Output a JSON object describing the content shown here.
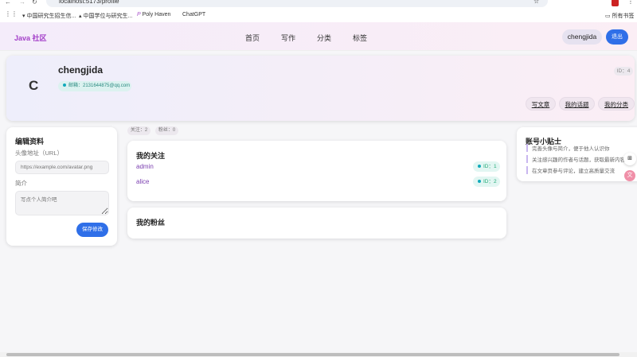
{
  "browser": {
    "url": "localhost:5173/profile",
    "bookmarks": [
      "中国研究生招生信...",
      "中国学位与研究生...",
      "Poly Haven",
      "ChatGPT"
    ],
    "all_bookmarks": "所有书签"
  },
  "nav": {
    "logo": "Java 社区",
    "links": [
      "首页",
      "写作",
      "分类",
      "标签"
    ],
    "user": "chengjida",
    "logout": "退出"
  },
  "profile": {
    "avatar_letter": "C",
    "username": "chengjida",
    "email": "邮箱：2131644875@qq.com",
    "id": "ID：4",
    "actions": [
      "写文章",
      "我的话题",
      "我的分类"
    ]
  },
  "edit": {
    "title": "编辑资料",
    "avatar_label": "头像地址（URL）",
    "avatar_placeholder": "https://example.com/avatar.png",
    "bio_label": "简介",
    "bio_placeholder": "写点个人简介吧",
    "save": "保存修改"
  },
  "stats": {
    "following": "关注：2",
    "followers": "粉丝：0"
  },
  "following": {
    "title": "我的关注",
    "items": [
      {
        "name": "admin",
        "id": "ID：1"
      },
      {
        "name": "alice",
        "id": "ID：2"
      }
    ]
  },
  "fans": {
    "title": "我的粉丝"
  },
  "tips": {
    "title": "账号小贴士",
    "items": [
      "完善头像与简介，便于他人认识你",
      "关注感兴趣的作者与话题，获取最新内容",
      "在文章页参与评论，建立高质量交流"
    ]
  }
}
